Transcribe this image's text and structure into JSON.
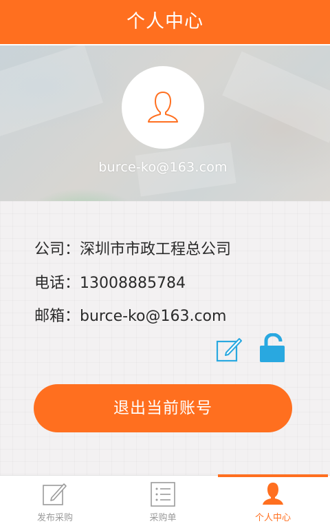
{
  "header": {
    "title": "个人中心"
  },
  "profile": {
    "email_display": "burce-ko@163.com"
  },
  "info": {
    "company": "公司：深圳市市政工程总公司",
    "phone": "电话：13008885784",
    "email": "邮箱：burce-ko@163.com"
  },
  "actions": {
    "edit_icon": "edit-icon",
    "lock_icon": "unlock-icon",
    "logout_label": "退出当前账号"
  },
  "tabs": [
    {
      "label": "发布采购",
      "icon": "edit-icon",
      "active": false
    },
    {
      "label": "采购单",
      "icon": "list-icon",
      "active": false
    },
    {
      "label": "个人中心",
      "icon": "person-icon",
      "active": true
    }
  ],
  "colors": {
    "accent": "#ff6f1f",
    "icon_blue": "#29a8e0",
    "tab_inactive": "#9a9a9a"
  }
}
